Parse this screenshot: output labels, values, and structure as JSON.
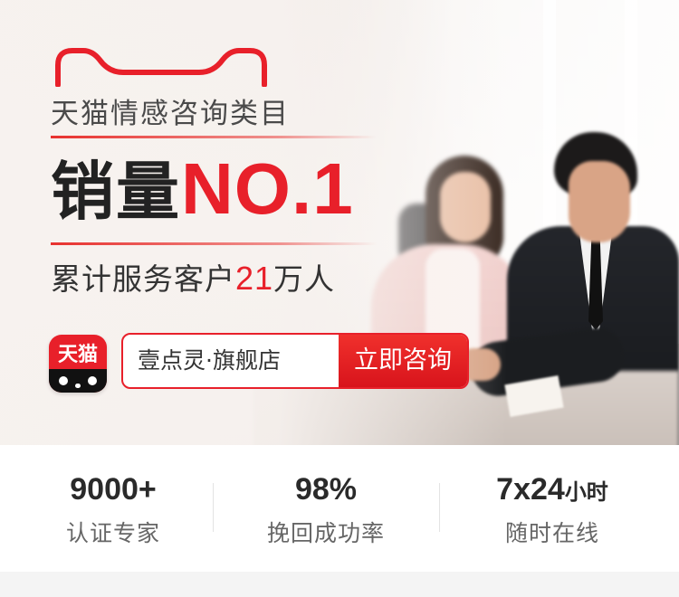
{
  "banner": {
    "slogan": "天猫情感咨询类目",
    "headline_dark": "销量",
    "headline_red": "NO.1",
    "sub_prefix": "累计服务客户",
    "sub_number": "21",
    "sub_suffix": "万人",
    "app_icon_text": "天猫",
    "store_name": "壹点灵·旗舰店",
    "consult_button": "立即咨询",
    "accent_color": "#e8202a"
  },
  "stats": [
    {
      "value": "9000+",
      "unit": "",
      "label": "认证专家"
    },
    {
      "value": "98%",
      "unit": "",
      "label": "挽回成功率"
    },
    {
      "value": "7x24",
      "unit": "小时",
      "label": "随时在线"
    }
  ]
}
